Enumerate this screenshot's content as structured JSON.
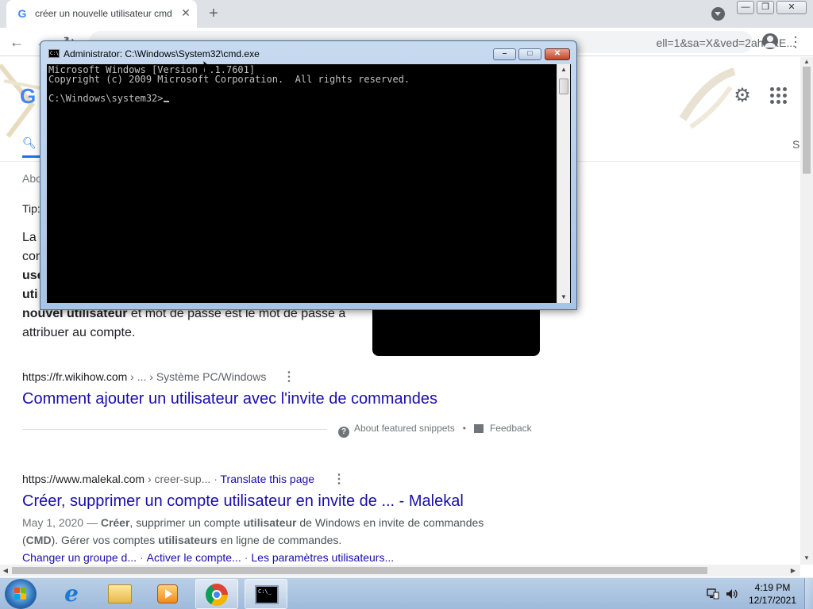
{
  "browser": {
    "tab_title": "créer un nouvelle utilisateur cmd",
    "tab_close": "✕",
    "new_tab": "+",
    "url": "...ved=2ahUKE...",
    "url_tail": "ell=1&sa=X&ved=2ahUKE...",
    "window_buttons": {
      "minimize": "—",
      "maximize": "❐",
      "close": "✕"
    },
    "nav": {
      "back": "←",
      "forward": "→",
      "reload": "↻"
    },
    "star": "☆",
    "menu": "⋮"
  },
  "google": {
    "logo_letter": "G",
    "settings_glyph": "⚙",
    "tab_edge_letter": "S",
    "snippet_left": {
      "about": "Abo",
      "tip": "Tip:",
      "l1": "La",
      "l2": "com",
      "l3": "use",
      "l4": "uti",
      "l5_bold": "nouvel utilisateur",
      "l5_rest": " et mot de passe est le mot de passe à",
      "l6": "attribuer au compte."
    },
    "result1": {
      "cite_domain": "https://fr.wikihow.com",
      "cite_path": " › ... › Système PC/Windows",
      "title": "Comment ajouter un utilisateur avec l'invite de commandes",
      "about_snippets": "About featured snippets",
      "bullet": "•",
      "feedback": "Feedback"
    },
    "result2": {
      "cite_domain": "https://www.malekal.com",
      "cite_path": " › creer-sup...",
      "translate": "Translate this page",
      "title": "Créer, supprimer un compte utilisateur en invite de ... - Malekal",
      "date": "May 1, 2020 — ",
      "d1_b1": "Créer",
      "d1_t1": ", supprimer un compte ",
      "d1_b2": "utilisateur",
      "d1_t2": " de Windows en invite de commandes",
      "d2_t0": "(",
      "d2_b1": "CMD",
      "d2_t1": "). Gérer vos comptes ",
      "d2_b2": "utilisateurs",
      "d2_t2": " en ligne de commandes.",
      "sitelinks": [
        "Changer un groupe d...",
        "Activer le compte...",
        "Les paramètres utilisateurs..."
      ],
      "sitelink_sep": "·"
    }
  },
  "cmd": {
    "title": "Administrator: C:\\Windows\\System32\\cmd.exe",
    "line1": "Microsoft Windows [Version 6.1.7601]",
    "line2": "Copyright (c) 2009 Microsoft Corporation.  All rights reserved.",
    "line3": "",
    "prompt": "C:\\Windows\\system32>",
    "icon_text": "C:\\"
  },
  "taskbar": {
    "clock_time": "4:19 PM",
    "clock_date": "12/17/2021",
    "ie_glyph": "e",
    "cmd_icon_text": "C:\\_"
  }
}
